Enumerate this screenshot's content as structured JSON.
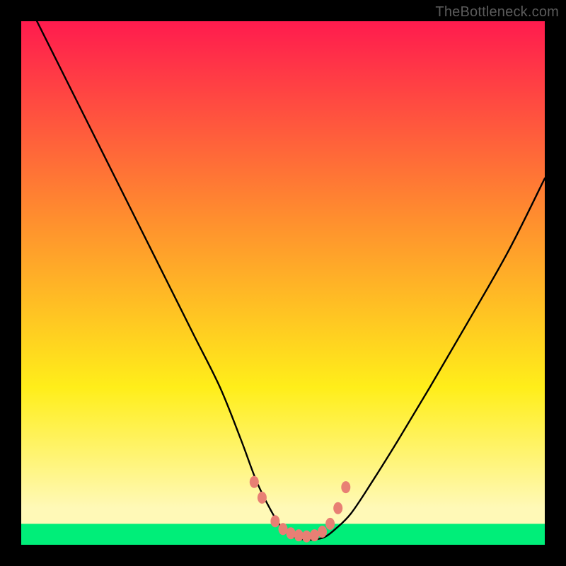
{
  "watermark": "TheBottleneck.com",
  "colors": {
    "frame": "#000000",
    "curve": "#000000",
    "markers": "#e87f74",
    "optimal": "#00ee79",
    "gradient_top": "#ff1b4e",
    "gradient_mid1": "#ff8f2e",
    "gradient_mid2": "#ffee1a",
    "gradient_bottom": "#fff9b7"
  },
  "chart_data": {
    "type": "line",
    "title": "",
    "xlabel": "",
    "ylabel": "",
    "xlim": [
      0,
      100
    ],
    "ylim": [
      0,
      100
    ],
    "grid": false,
    "legend": false,
    "optimal_band_y": [
      0,
      4
    ],
    "series": [
      {
        "name": "bottleneck-curve",
        "x": [
          3,
          8,
          13,
          18,
          23,
          28,
          33,
          38,
          42,
          45,
          48,
          50,
          52,
          54,
          56,
          58,
          60,
          63,
          67,
          72,
          78,
          85,
          93,
          100
        ],
        "y": [
          100,
          90,
          80,
          70,
          60,
          50,
          40,
          30,
          20,
          12,
          6,
          3,
          1.5,
          1,
          1,
          1.5,
          3,
          6,
          12,
          20,
          30,
          42,
          56,
          70
        ]
      }
    ],
    "markers": {
      "name": "highlight-points",
      "x": [
        44.5,
        46,
        48.5,
        50,
        51.5,
        53,
        54.5,
        56,
        57.5,
        59,
        60.5,
        62
      ],
      "y": [
        12,
        9,
        4.5,
        3,
        2.2,
        1.8,
        1.6,
        1.8,
        2.5,
        4,
        7,
        11
      ]
    }
  }
}
